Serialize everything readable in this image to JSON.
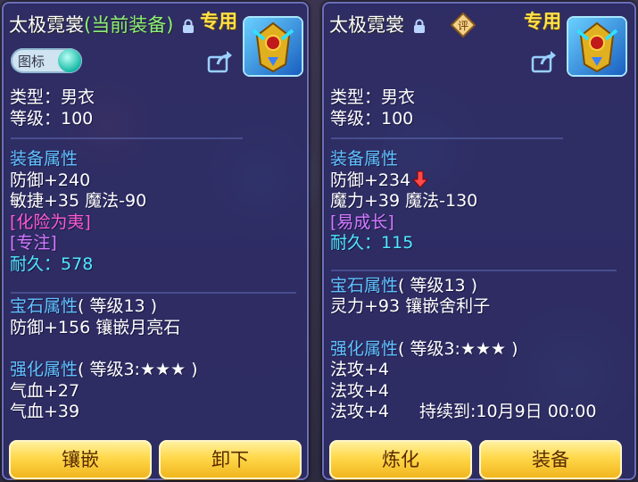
{
  "left": {
    "name": "太极霓裳",
    "current_tag": "(当前装备)",
    "exclusive": "专用",
    "toggle_label": "图标",
    "type_line": "类型：男衣",
    "level_line": "等级：100",
    "equip_header": "装备属性",
    "attr1": "防御+240",
    "attr2": "敏捷+35 魔法-90",
    "special1": "[化险为夷]",
    "special2": "[专注]",
    "durability_label": "耐久：",
    "durability_value": "578",
    "gem_header": "宝石属性",
    "gem_level": "( 等级13 )",
    "gem_line": "防御+156 镶嵌月亮石",
    "refine_header": "强化属性",
    "refine_level": "( 等级3:★★★ )",
    "refine1": "气血+27",
    "refine2": "气血+39",
    "button_left": "镶嵌",
    "button_right": "卸下"
  },
  "right": {
    "name": "太极霓裳",
    "rate_badge": "评",
    "exclusive": "专用",
    "type_line": "类型：男衣",
    "level_line": "等级：100",
    "equip_header": "装备属性",
    "attr1": "防御+234",
    "attr2": "魔力+39 魔法-130",
    "special1": "[易成长]",
    "durability_label": "耐久：",
    "durability_value": "115",
    "gem_header": "宝石属性",
    "gem_level": "( 等级13 )",
    "gem_line": "灵力+93 镶嵌舍利子",
    "refine_header": "强化属性",
    "refine_level": "( 等级3:★★★ )",
    "refine1": "法攻+4",
    "refine2": "法攻+4",
    "refine3": "法攻+4",
    "refine3_duration": "持续到:10月9日 00:00",
    "button_left": "炼化",
    "button_right": "装备"
  },
  "icons": {
    "lock": "lock-icon",
    "share": "share-icon",
    "avatar": "armor-icon",
    "compare_down": "arrow-down-icon"
  },
  "colors": {
    "panel": "#2e2c68",
    "title": "#ffffff",
    "current_equipped": "#8cf07a",
    "exclusive": "#ffe24a",
    "section": "#60c2ff",
    "special_magenta": "#ff5ad2",
    "special_purple": "#d479ff",
    "durability": "#4fe8ff",
    "button": "#ffd84a",
    "down_arrow": "#ff4a4a"
  }
}
